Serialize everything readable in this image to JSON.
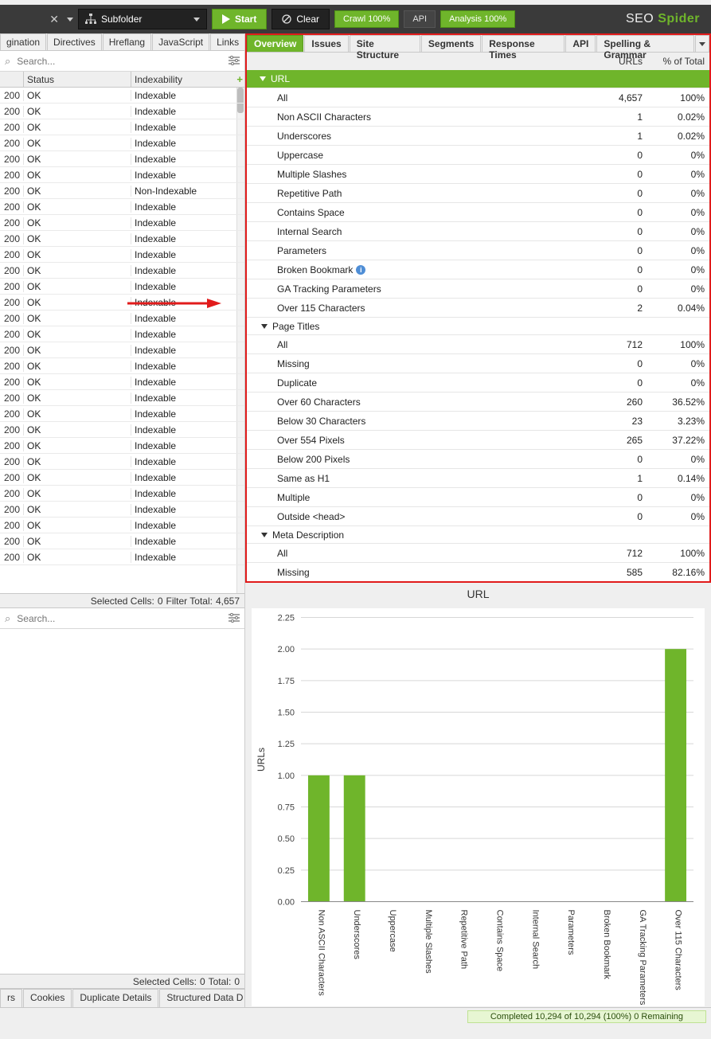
{
  "brand": {
    "seo": "SEO",
    "spider": "Spider"
  },
  "toolbar": {
    "subfolder": "Subfolder",
    "start": "Start",
    "clear": "Clear",
    "crawl": "Crawl 100%",
    "api": "API",
    "analysis": "Analysis 100%"
  },
  "left_tabs": [
    "gination",
    "Directives",
    "Hreflang",
    "JavaScript",
    "Links"
  ],
  "search_placeholder": "Search...",
  "grid_headers": {
    "status": "Status",
    "indexability": "Indexability"
  },
  "grid_rows": [
    {
      "code": "200",
      "status": "OK",
      "index": "Indexable"
    },
    {
      "code": "200",
      "status": "OK",
      "index": "Indexable"
    },
    {
      "code": "200",
      "status": "OK",
      "index": "Indexable"
    },
    {
      "code": "200",
      "status": "OK",
      "index": "Indexable"
    },
    {
      "code": "200",
      "status": "OK",
      "index": "Indexable"
    },
    {
      "code": "200",
      "status": "OK",
      "index": "Indexable"
    },
    {
      "code": "200",
      "status": "OK",
      "index": "Non-Indexable"
    },
    {
      "code": "200",
      "status": "OK",
      "index": "Indexable"
    },
    {
      "code": "200",
      "status": "OK",
      "index": "Indexable"
    },
    {
      "code": "200",
      "status": "OK",
      "index": "Indexable"
    },
    {
      "code": "200",
      "status": "OK",
      "index": "Indexable"
    },
    {
      "code": "200",
      "status": "OK",
      "index": "Indexable"
    },
    {
      "code": "200",
      "status": "OK",
      "index": "Indexable"
    },
    {
      "code": "200",
      "status": "OK",
      "index": "Indexable"
    },
    {
      "code": "200",
      "status": "OK",
      "index": "Indexable"
    },
    {
      "code": "200",
      "status": "OK",
      "index": "Indexable"
    },
    {
      "code": "200",
      "status": "OK",
      "index": "Indexable"
    },
    {
      "code": "200",
      "status": "OK",
      "index": "Indexable"
    },
    {
      "code": "200",
      "status": "OK",
      "index": "Indexable"
    },
    {
      "code": "200",
      "status": "OK",
      "index": "Indexable"
    },
    {
      "code": "200",
      "status": "OK",
      "index": "Indexable"
    },
    {
      "code": "200",
      "status": "OK",
      "index": "Indexable"
    },
    {
      "code": "200",
      "status": "OK",
      "index": "Indexable"
    },
    {
      "code": "200",
      "status": "OK",
      "index": "Indexable"
    },
    {
      "code": "200",
      "status": "OK",
      "index": "Indexable"
    },
    {
      "code": "200",
      "status": "OK",
      "index": "Indexable"
    },
    {
      "code": "200",
      "status": "OK",
      "index": "Indexable"
    },
    {
      "code": "200",
      "status": "OK",
      "index": "Indexable"
    },
    {
      "code": "200",
      "status": "OK",
      "index": "Indexable"
    },
    {
      "code": "200",
      "status": "OK",
      "index": "Indexable"
    }
  ],
  "grid_footer": {
    "selected": "Selected Cells:",
    "selected_n": "0",
    "filter": "Filter Total:",
    "filter_n": "4,657"
  },
  "right_tabs": [
    "Overview",
    "Issues",
    "Site Structure",
    "Segments",
    "Response Times",
    "API",
    "Spelling & Grammar"
  ],
  "ov_headers": {
    "urls": "URLs",
    "pct": "% of Total"
  },
  "url_group": "URL",
  "url_rows": [
    {
      "label": "All",
      "urls": "4,657",
      "pct": "100%"
    },
    {
      "label": "Non ASCII Characters",
      "urls": "1",
      "pct": "0.02%"
    },
    {
      "label": "Underscores",
      "urls": "1",
      "pct": "0.02%"
    },
    {
      "label": "Uppercase",
      "urls": "0",
      "pct": "0%"
    },
    {
      "label": "Multiple Slashes",
      "urls": "0",
      "pct": "0%"
    },
    {
      "label": "Repetitive Path",
      "urls": "0",
      "pct": "0%"
    },
    {
      "label": "Contains Space",
      "urls": "0",
      "pct": "0%"
    },
    {
      "label": "Internal Search",
      "urls": "0",
      "pct": "0%"
    },
    {
      "label": "Parameters",
      "urls": "0",
      "pct": "0%"
    },
    {
      "label": "Broken Bookmark",
      "info": true,
      "urls": "0",
      "pct": "0%"
    },
    {
      "label": "GA Tracking Parameters",
      "urls": "0",
      "pct": "0%"
    },
    {
      "label": "Over 115 Characters",
      "urls": "2",
      "pct": "0.04%"
    }
  ],
  "pt_group": "Page Titles",
  "pt_rows": [
    {
      "label": "All",
      "urls": "712",
      "pct": "100%"
    },
    {
      "label": "Missing",
      "urls": "0",
      "pct": "0%"
    },
    {
      "label": "Duplicate",
      "urls": "0",
      "pct": "0%"
    },
    {
      "label": "Over 60 Characters",
      "urls": "260",
      "pct": "36.52%"
    },
    {
      "label": "Below 30 Characters",
      "urls": "23",
      "pct": "3.23%"
    },
    {
      "label": "Over 554 Pixels",
      "urls": "265",
      "pct": "37.22%"
    },
    {
      "label": "Below 200 Pixels",
      "urls": "0",
      "pct": "0%"
    },
    {
      "label": "Same as H1",
      "urls": "1",
      "pct": "0.14%"
    },
    {
      "label": "Multiple",
      "urls": "0",
      "pct": "0%"
    },
    {
      "label": "Outside <head>",
      "urls": "0",
      "pct": "0%"
    }
  ],
  "md_group": "Meta Description",
  "md_rows": [
    {
      "label": "All",
      "urls": "712",
      "pct": "100%"
    },
    {
      "label": "Missing",
      "urls": "585",
      "pct": "82.16%"
    }
  ],
  "lower_foot": {
    "selected": "Selected Cells:",
    "selected_n": "0",
    "total": "Total:",
    "total_n": "0"
  },
  "bottom_tabs": [
    "rs",
    "Cookies",
    "Duplicate Details",
    "Structured Data D"
  ],
  "status": "Completed 10,294 of 10,294 (100%) 0 Remaining",
  "chart_data": {
    "type": "bar",
    "title": "URL",
    "ylabel": "URLs",
    "ylim": [
      0,
      2.25
    ],
    "yticks": [
      0.0,
      0.25,
      0.5,
      0.75,
      1.0,
      1.25,
      1.5,
      1.75,
      2.0,
      2.25
    ],
    "categories": [
      "Non ASCII Characters",
      "Underscores",
      "Uppercase",
      "Multiple Slashes",
      "Repetitive Path",
      "Contains Space",
      "Internal Search",
      "Parameters",
      "Broken Bookmark",
      "GA Tracking Parameters",
      "Over 115 Characters"
    ],
    "values": [
      1,
      1,
      0,
      0,
      0,
      0,
      0,
      0,
      0,
      0,
      2
    ]
  }
}
